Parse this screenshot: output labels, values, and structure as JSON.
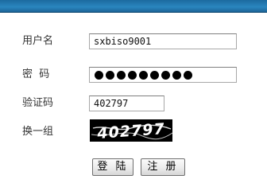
{
  "form": {
    "username_label": "用户名",
    "username_value": "sxbiso9001",
    "password_label": "密  码",
    "password_dot_count": 9,
    "captcha_label": "验证码",
    "captcha_value": "402797",
    "refresh_label": "换一组",
    "captcha_image_text": "402797"
  },
  "buttons": {
    "login": "登 陆",
    "register": "注 册"
  },
  "colors": {
    "header": "#2a86bf",
    "captcha_bg": "#000000"
  }
}
